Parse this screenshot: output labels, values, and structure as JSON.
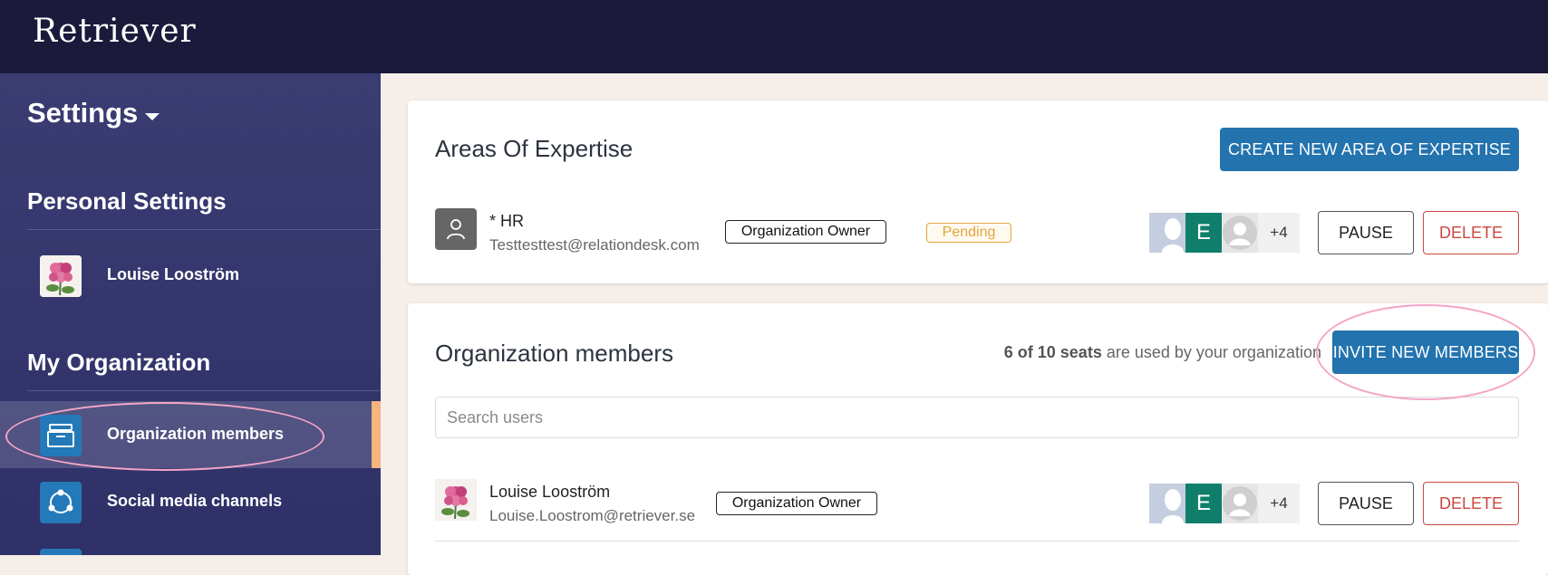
{
  "app": {
    "logo": "Retriever"
  },
  "sidebar": {
    "title": "Settings",
    "personal_section": "Personal Settings",
    "user_name": "Louise Looström",
    "org_section": "My Organization",
    "items": [
      {
        "label": "Organization members",
        "icon": "inbox-icon",
        "active": true
      },
      {
        "label": "Social media channels",
        "icon": "share-network-icon",
        "active": false
      }
    ]
  },
  "expertise": {
    "title": "Areas Of Expertise",
    "create_button": "CREATE NEW AREA OF EXPERTISE",
    "row": {
      "name": "* HR",
      "email": "Testtesttest@relationdesk.com",
      "role": "Organization Owner",
      "status": "Pending",
      "avatar_letter": "E",
      "more_count": "+4",
      "pause": "PAUSE",
      "delete": "DELETE"
    }
  },
  "members": {
    "title": "Organization members",
    "seats_used": "6 of 10 seats",
    "seats_suffix": "are used by your organization",
    "invite_button": "INVITE NEW MEMBERS",
    "search_placeholder": "Search users",
    "rows": [
      {
        "name": "Louise Looström",
        "email": "Louise.Loostrom@retriever.se",
        "role": "Organization Owner",
        "avatar_letter": "E",
        "more_count": "+4",
        "pause": "PAUSE",
        "delete": "DELETE"
      }
    ]
  },
  "colors": {
    "topbar": "#1b1a3a",
    "sidebar": "#35376e",
    "primary": "#2373ae",
    "delete": "#c9483f",
    "pending": "#e2a43b",
    "active_accent": "#f4b57e",
    "annotation": "#f4a6c8"
  }
}
